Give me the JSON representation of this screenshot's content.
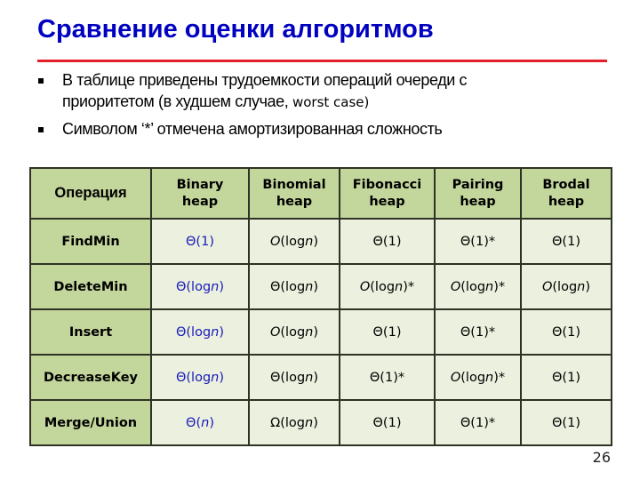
{
  "slide": {
    "title": "Сравнение оценки алгоритмов",
    "accent_color": "#e3202a",
    "title_color": "#0000c0",
    "page_number": "26"
  },
  "bullets": [
    {
      "text": "В таблице приведены трудоемкости операций очереди  с приоритетом (в худшем случае, ",
      "tail": "worst case)"
    },
    {
      "text": "Символом ‘*’ отмечена амортизированная сложность",
      "tail": ""
    }
  ],
  "table": {
    "header_color": "#c3d69b",
    "cell_color": "#ebf1de",
    "highlight_color": "#1a1ab8",
    "columns": [
      {
        "line1": "Операция",
        "line2": ""
      },
      {
        "line1": "Binary",
        "line2": "heap"
      },
      {
        "line1": "Binomial",
        "line2": "heap"
      },
      {
        "line1": "Fibonacci",
        "line2": "heap"
      },
      {
        "line1": "Pairing",
        "line2": "heap"
      },
      {
        "line1": "Brodal",
        "line2": "heap"
      }
    ],
    "rows": [
      {
        "operation": "FindMin",
        "cells": [
          {
            "sym": "Θ",
            "arg": "1",
            "italic_n": false,
            "suffix": ""
          },
          {
            "sym": "O",
            "arg": "log",
            "italic_n": true,
            "suffix": ""
          },
          {
            "sym": "Θ",
            "arg": "1",
            "italic_n": false,
            "suffix": ""
          },
          {
            "sym": "Θ",
            "arg": "1",
            "italic_n": false,
            "suffix": "*"
          },
          {
            "sym": "Θ",
            "arg": "1",
            "italic_n": false,
            "suffix": ""
          }
        ]
      },
      {
        "operation": "DeleteMin",
        "cells": [
          {
            "sym": "Θ",
            "arg": "log",
            "italic_n": true,
            "suffix": ""
          },
          {
            "sym": "Θ",
            "arg": "log",
            "italic_n": true,
            "suffix": ""
          },
          {
            "sym": "O",
            "arg": "log",
            "italic_n": true,
            "suffix": "*"
          },
          {
            "sym": "O",
            "arg": "log",
            "italic_n": true,
            "suffix": "*"
          },
          {
            "sym": "O",
            "arg": "log",
            "italic_n": true,
            "suffix": ""
          }
        ]
      },
      {
        "operation": "Insert",
        "cells": [
          {
            "sym": "Θ",
            "arg": "log",
            "italic_n": true,
            "suffix": ""
          },
          {
            "sym": "O",
            "arg": "log",
            "italic_n": true,
            "suffix": ""
          },
          {
            "sym": "Θ",
            "arg": "1",
            "italic_n": false,
            "suffix": ""
          },
          {
            "sym": "Θ",
            "arg": "1",
            "italic_n": false,
            "suffix": "*"
          },
          {
            "sym": "Θ",
            "arg": "1",
            "italic_n": false,
            "suffix": ""
          }
        ]
      },
      {
        "operation": "DecreaseKey",
        "cells": [
          {
            "sym": "Θ",
            "arg": "log",
            "italic_n": true,
            "suffix": ""
          },
          {
            "sym": "Θ",
            "arg": "log",
            "italic_n": true,
            "suffix": ""
          },
          {
            "sym": "Θ",
            "arg": "1",
            "italic_n": false,
            "suffix": "*"
          },
          {
            "sym": "O",
            "arg": "log",
            "italic_n": true,
            "suffix": "*"
          },
          {
            "sym": "Θ",
            "arg": "1",
            "italic_n": false,
            "suffix": ""
          }
        ]
      },
      {
        "operation": "Merge/Union",
        "cells": [
          {
            "sym": "Θ",
            "arg": "",
            "italic_n": true,
            "suffix": ""
          },
          {
            "sym": "Ω",
            "arg": "log",
            "italic_n": true,
            "suffix": ""
          },
          {
            "sym": "Θ",
            "arg": "1",
            "italic_n": false,
            "suffix": ""
          },
          {
            "sym": "Θ",
            "arg": "1",
            "italic_n": false,
            "suffix": "*"
          },
          {
            "sym": "Θ",
            "arg": "1",
            "italic_n": false,
            "suffix": ""
          }
        ]
      }
    ],
    "highlighted_column": 0
  }
}
